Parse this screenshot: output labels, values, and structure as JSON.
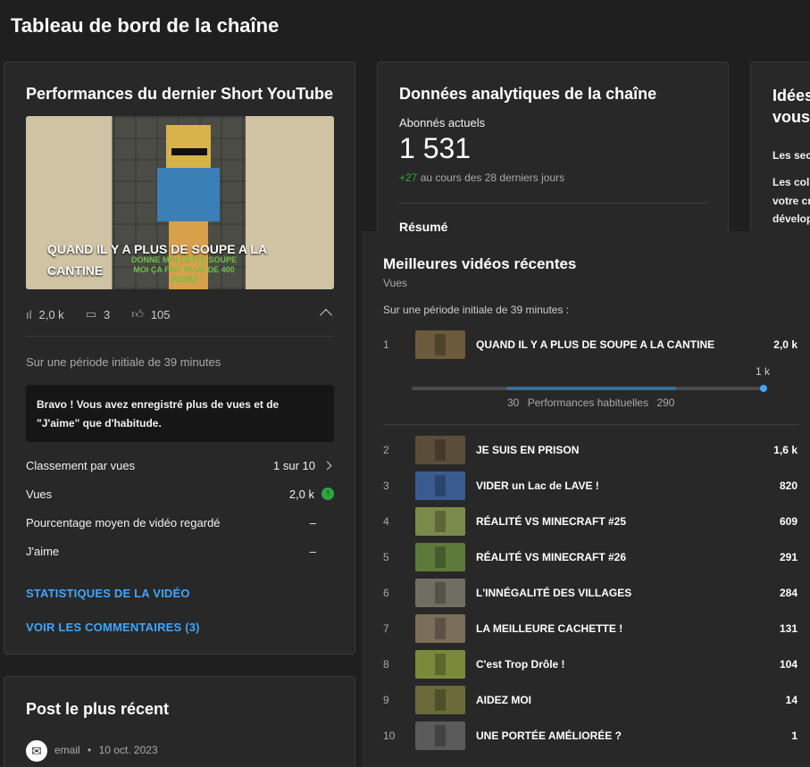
{
  "page_title": "Tableau de bord de la chaîne",
  "short_card": {
    "title": "Performances du dernier Short YouTube",
    "thumbnail_caption": "QUAND IL Y A PLUS DE SOUPE A LA CANTINE",
    "thumbnail_subcaption": "DONNE MOI CETTE SOUPE\nMOI ÇA FAIT PLUS DE 400 JOURS",
    "views": "2,0 k",
    "comments": "3",
    "likes": "105",
    "period": "Sur une période initiale de 39 minutes",
    "bravo": "Bravo ! Vous avez enregistré plus de vues et de \"J'aime\" que d'habitude.",
    "metrics": [
      {
        "label": "Classement par vues",
        "value": "1 sur 10"
      },
      {
        "label": "Vues",
        "value": "2,0 k"
      },
      {
        "label": "Pourcentage moyen de vidéo regardé",
        "value": "–"
      },
      {
        "label": "J'aime",
        "value": "–"
      }
    ],
    "link_stats": "STATISTIQUES DE LA VIDÉO",
    "link_comments": "VOIR LES COMMENTAIRES (3)"
  },
  "post_card": {
    "title": "Post le plus récent",
    "author": "email",
    "separator": "•",
    "date": "10 oct. 2023"
  },
  "analytics_card": {
    "title": "Données analytiques de la chaîne",
    "subs_label": "Abonnés actuels",
    "subs_value": "1 531",
    "subs_change": "+27",
    "subs_change_suffix": "au cours des 28 derniers jours",
    "summary": "Résumé"
  },
  "ideas_card": {
    "title_line1": "Idées",
    "title_line2": "vous",
    "line1": "Les sec",
    "line2": "Les col",
    "line3": "votre cr",
    "line4": "dévelop"
  },
  "top_videos": {
    "title": "Meilleures vidéos récentes",
    "subtitle": "Vues",
    "period": "Sur une période initiale de 39 minutes :",
    "perf_max": "1 k",
    "perf_low": "30",
    "perf_label": "Performances habituelles",
    "perf_high": "290",
    "videos": [
      {
        "rank": "1",
        "title": "QUAND IL Y A PLUS DE SOUPE A LA CANTINE",
        "views": "2,0 k",
        "color": "#6b5a3c"
      },
      {
        "rank": "2",
        "title": "JE SUIS EN PRISON",
        "views": "1,6 k",
        "color": "#5a4e3a"
      },
      {
        "rank": "3",
        "title": "VIDER un Lac de LAVE !",
        "views": "820",
        "color": "#3a5b8f"
      },
      {
        "rank": "4",
        "title": "RÉALITÉ VS MINECRAFT #25",
        "views": "609",
        "color": "#7a8a4a"
      },
      {
        "rank": "5",
        "title": "RÉALITÉ VS MINECRAFT #26",
        "views": "291",
        "color": "#5d7a3a"
      },
      {
        "rank": "6",
        "title": "L'INNÉGALITÉ DES VILLAGES",
        "views": "284",
        "color": "#6e6e62"
      },
      {
        "rank": "7",
        "title": "LA MEILLEURE CACHETTE !",
        "views": "131",
        "color": "#7a6e5a"
      },
      {
        "rank": "8",
        "title": "C'est Trop Drôle !",
        "views": "104",
        "color": "#7a8a3a"
      },
      {
        "rank": "9",
        "title": "AIDEZ MOI",
        "views": "14",
        "color": "#6a6a3a"
      },
      {
        "rank": "10",
        "title": "UNE PORTÉE AMÉLIORÉE ?",
        "views": "1",
        "color": "#5a5a5a"
      }
    ]
  }
}
